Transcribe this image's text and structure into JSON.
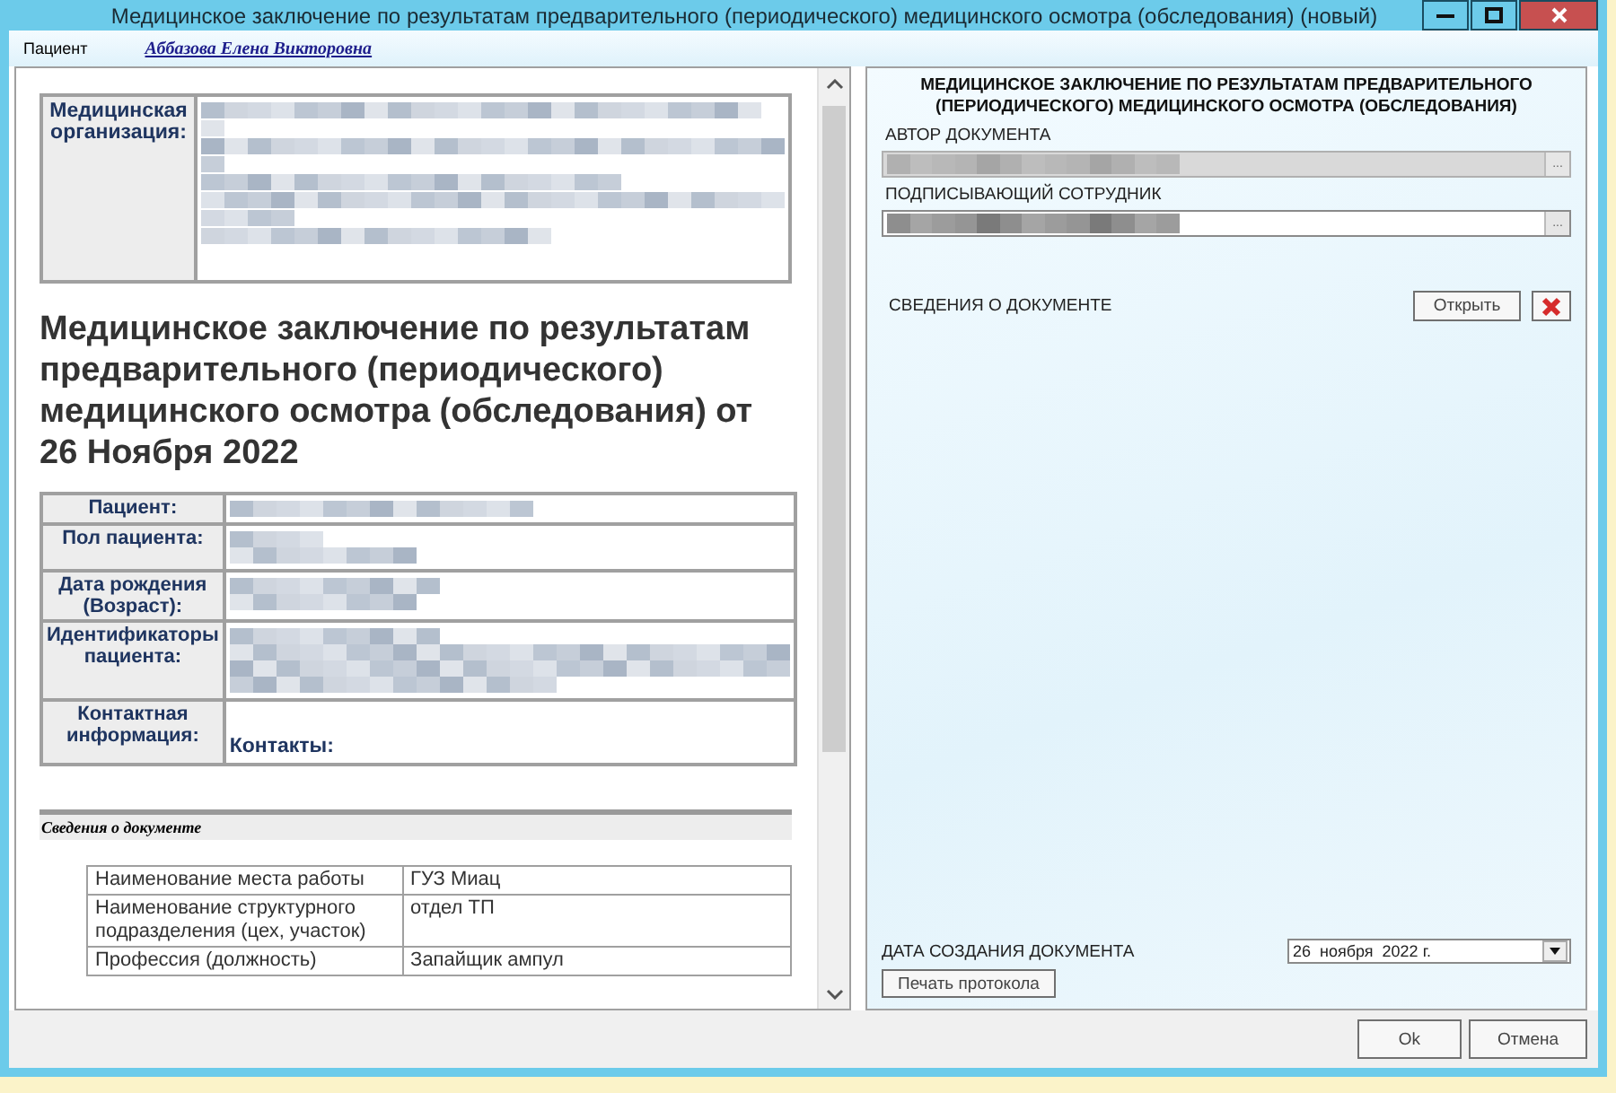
{
  "window": {
    "title": "Медицинское заключение по результатам предварительного (периодического) медицинского осмотра (обследования) (новый)"
  },
  "patient_bar": {
    "label": "Пациент",
    "name_link": "Аббазова Елена Викторовна"
  },
  "document": {
    "org_label": "Медицинская организация:",
    "heading": "Медицинское заключение по результатам предварительного (периодического) медицинского осмотра (обследования) от 26 Ноября 2022",
    "patient_rows": [
      {
        "label": "Пациент:"
      },
      {
        "label": "Пол пациента:"
      },
      {
        "label": "Дата рождения (Возраст):"
      },
      {
        "label": "Идентификаторы пациента:"
      },
      {
        "label": "Контактная информация:",
        "value": "Контакты:"
      }
    ],
    "section_title": "Сведения о документе",
    "info_rows": [
      {
        "name": "Наименование места работы",
        "value": "ГУЗ Миац"
      },
      {
        "name": "Наименование структурного подразделения (цех, участок)",
        "value": "отдел ТП"
      },
      {
        "name": "Профессия (должность)",
        "value": "Запайщик ампул"
      }
    ]
  },
  "panel": {
    "title": "МЕДИЦИНСКОЕ ЗАКЛЮЧЕНИЕ ПО РЕЗУЛЬТАТАМ ПРЕДВАРИТЕЛЬНОГО (ПЕРИОДИЧЕСКОГО) МЕДИЦИНСКОГО ОСМОТРА (ОБСЛЕДОВАНИЯ)",
    "fields": [
      {
        "label": "АВТОР ДОКУМЕНТА",
        "disabled": true,
        "button": "..."
      },
      {
        "label": "ПОДПИСЫВАЮЩИЙ СОТРУДНИК",
        "disabled": false,
        "button": "..."
      }
    ],
    "doc_info_label": "СВЕДЕНИЯ О ДОКУМЕНТЕ",
    "open_button": "Открыть",
    "date_label": "ДАТА СОЗДАНИЯ ДОКУМЕНТА",
    "date_value": "26  ноября  2022 г.",
    "print_button": "Печать протокола"
  },
  "buttons": [
    "Ok",
    "Отмена"
  ]
}
